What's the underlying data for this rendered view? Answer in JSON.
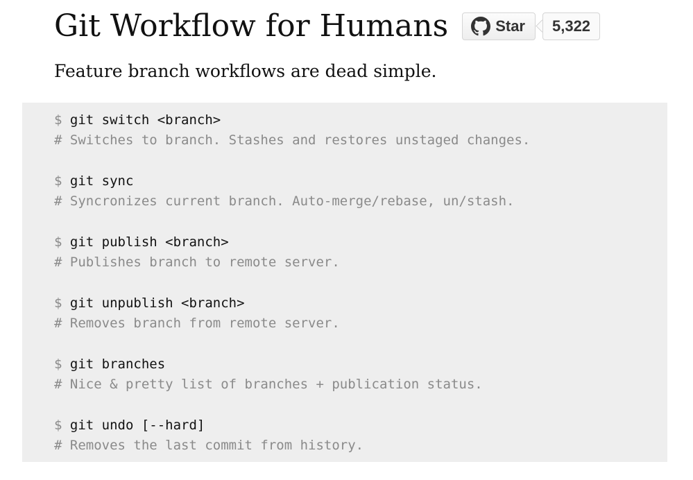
{
  "header": {
    "title": "Git Workflow for Humans",
    "github": {
      "star_label": "Star",
      "star_count": "5,322",
      "icon": "github-octocat-icon"
    }
  },
  "tagline": "Feature branch workflows are dead simple.",
  "commands": [
    {
      "prompt": "$",
      "command": "git switch <branch>",
      "comment": "# Switches to branch. Stashes and restores unstaged changes."
    },
    {
      "prompt": "$",
      "command": "git sync",
      "comment": "# Syncronizes current branch. Auto-merge/rebase, un/stash."
    },
    {
      "prompt": "$",
      "command": "git publish <branch>",
      "comment": "# Publishes branch to remote server."
    },
    {
      "prompt": "$",
      "command": "git unpublish <branch>",
      "comment": "# Removes branch from remote server."
    },
    {
      "prompt": "$",
      "command": "git branches",
      "comment": "# Nice & pretty list of branches + publication status."
    },
    {
      "prompt": "$",
      "command": "git undo [--hard]",
      "comment": "# Removes the last commit from history."
    }
  ],
  "colors": {
    "code_background": "#eeeeee",
    "comment_text": "#8a8a8a",
    "button_border": "#d5d5d5"
  }
}
